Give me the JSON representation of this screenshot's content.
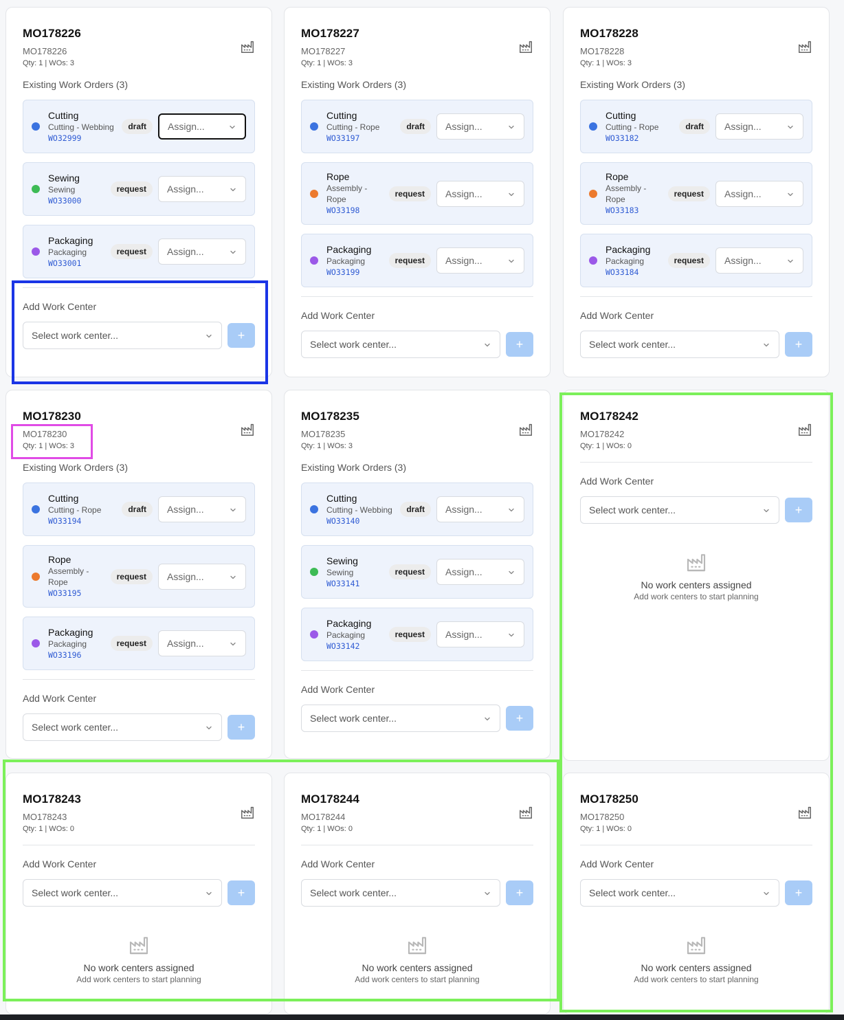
{
  "cards": [
    {
      "id": "MO178226",
      "subtitle": "MO178226",
      "qty": "Qty: 1 | WOs: 3",
      "existing_label": "Existing Work Orders (3)",
      "work_orders": [
        {
          "name": "Cutting",
          "op": "Cutting - Webbing",
          "code": "WO32999",
          "status": "draft",
          "color": "#3b73e0",
          "assign": "Assign..."
        },
        {
          "name": "Sewing",
          "op": "Sewing",
          "code": "WO33000",
          "status": "request",
          "color": "#3dbb55",
          "assign": "Assign..."
        },
        {
          "name": "Packaging",
          "op": "Packaging",
          "code": "WO33001",
          "status": "request",
          "color": "#9b59e8",
          "assign": "Assign..."
        }
      ],
      "add_label": "Add Work Center",
      "select_placeholder": "Select work center...",
      "add_button": "+"
    },
    {
      "id": "MO178227",
      "subtitle": "MO178227",
      "qty": "Qty: 1 | WOs: 3",
      "existing_label": "Existing Work Orders (3)",
      "work_orders": [
        {
          "name": "Cutting",
          "op": "Cutting - Rope",
          "code": "WO33197",
          "status": "draft",
          "color": "#3b73e0",
          "assign": "Assign..."
        },
        {
          "name": "Rope",
          "op": "Assembly - Rope",
          "code": "WO33198",
          "status": "request",
          "color": "#ec7a2e",
          "assign": "Assign..."
        },
        {
          "name": "Packaging",
          "op": "Packaging",
          "code": "WO33199",
          "status": "request",
          "color": "#9b59e8",
          "assign": "Assign..."
        }
      ],
      "add_label": "Add Work Center",
      "select_placeholder": "Select work center...",
      "add_button": "+"
    },
    {
      "id": "MO178228",
      "subtitle": "MO178228",
      "qty": "Qty: 1 | WOs: 3",
      "existing_label": "Existing Work Orders (3)",
      "work_orders": [
        {
          "name": "Cutting",
          "op": "Cutting - Rope",
          "code": "WO33182",
          "status": "draft",
          "color": "#3b73e0",
          "assign": "Assign..."
        },
        {
          "name": "Rope",
          "op": "Assembly - Rope",
          "code": "WO33183",
          "status": "request",
          "color": "#ec7a2e",
          "assign": "Assign..."
        },
        {
          "name": "Packaging",
          "op": "Packaging",
          "code": "WO33184",
          "status": "request",
          "color": "#9b59e8",
          "assign": "Assign..."
        }
      ],
      "add_label": "Add Work Center",
      "select_placeholder": "Select work center...",
      "add_button": "+"
    },
    {
      "id": "MO178230",
      "subtitle": "MO178230",
      "qty": "Qty: 1 | WOs: 3",
      "existing_label": "Existing Work Orders (3)",
      "work_orders": [
        {
          "name": "Cutting",
          "op": "Cutting - Rope",
          "code": "WO33194",
          "status": "draft",
          "color": "#3b73e0",
          "assign": "Assign..."
        },
        {
          "name": "Rope",
          "op": "Assembly - Rope",
          "code": "WO33195",
          "status": "request",
          "color": "#ec7a2e",
          "assign": "Assign..."
        },
        {
          "name": "Packaging",
          "op": "Packaging",
          "code": "WO33196",
          "status": "request",
          "color": "#9b59e8",
          "assign": "Assign..."
        }
      ],
      "add_label": "Add Work Center",
      "select_placeholder": "Select work center...",
      "add_button": "+"
    },
    {
      "id": "MO178235",
      "subtitle": "MO178235",
      "qty": "Qty: 1 | WOs: 3",
      "existing_label": "Existing Work Orders (3)",
      "work_orders": [
        {
          "name": "Cutting",
          "op": "Cutting - Webbing",
          "code": "WO33140",
          "status": "draft",
          "color": "#3b73e0",
          "assign": "Assign..."
        },
        {
          "name": "Sewing",
          "op": "Sewing",
          "code": "WO33141",
          "status": "request",
          "color": "#3dbb55",
          "assign": "Assign..."
        },
        {
          "name": "Packaging",
          "op": "Packaging",
          "code": "WO33142",
          "status": "request",
          "color": "#9b59e8",
          "assign": "Assign..."
        }
      ],
      "add_label": "Add Work Center",
      "select_placeholder": "Select work center...",
      "add_button": "+"
    },
    {
      "id": "MO178242",
      "subtitle": "MO178242",
      "qty": "Qty: 1 | WOs: 0",
      "add_label": "Add Work Center",
      "select_placeholder": "Select work center...",
      "add_button": "+",
      "empty_title": "No work centers assigned",
      "empty_sub": "Add work centers to start planning"
    },
    {
      "id": "MO178243",
      "subtitle": "MO178243",
      "qty": "Qty: 1 | WOs: 0",
      "add_label": "Add Work Center",
      "select_placeholder": "Select work center...",
      "add_button": "+",
      "empty_title": "No work centers assigned",
      "empty_sub": "Add work centers to start planning"
    },
    {
      "id": "MO178244",
      "subtitle": "MO178244",
      "qty": "Qty: 1 | WOs: 0",
      "add_label": "Add Work Center",
      "select_placeholder": "Select work center...",
      "add_button": "+",
      "empty_title": "No work centers assigned",
      "empty_sub": "Add work centers to start planning"
    },
    {
      "id": "MO178250",
      "subtitle": "MO178250",
      "qty": "Qty: 1 | WOs: 0",
      "add_label": "Add Work Center",
      "select_placeholder": "Select work center...",
      "add_button": "+",
      "empty_title": "No work centers assigned",
      "empty_sub": "Add work centers to start planning"
    }
  ],
  "highlight_colors": {
    "blue": "#1a35e6",
    "magenta": "#e04be6",
    "green": "#7cf05a"
  }
}
